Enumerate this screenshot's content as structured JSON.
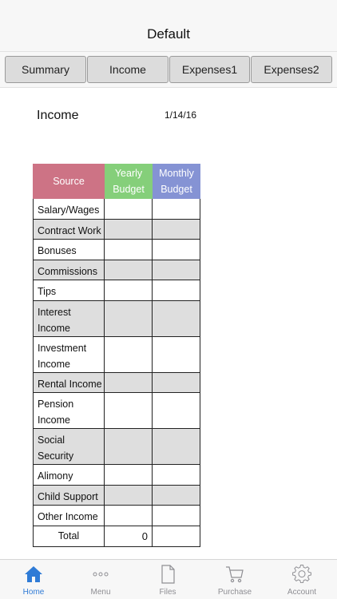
{
  "header": {
    "title": "Default"
  },
  "segments": [
    "Summary",
    "Income",
    "Expenses1",
    "Expenses2"
  ],
  "section": {
    "title": "Income",
    "date": "1/14/16"
  },
  "table": {
    "headers": {
      "source": "Source",
      "yearly_line1": "Yearly",
      "yearly_line2": "Budget",
      "monthly_line1": "Monthly",
      "monthly_line2": "Budget"
    },
    "rows": [
      {
        "line1": "Salary/Wages",
        "line2": ""
      },
      {
        "line1": "Contract Work",
        "line2": ""
      },
      {
        "line1": "Bonuses",
        "line2": ""
      },
      {
        "line1": "Commissions",
        "line2": ""
      },
      {
        "line1": "Tips",
        "line2": ""
      },
      {
        "line1": "Interest",
        "line2": "Income"
      },
      {
        "line1": "Investment",
        "line2": "Income"
      },
      {
        "line1": "Rental Income",
        "line2": ""
      },
      {
        "line1": "Pension",
        "line2": "Income"
      },
      {
        "line1": "Social",
        "line2": "Security"
      },
      {
        "line1": "Alimony",
        "line2": ""
      },
      {
        "line1": "Child Support",
        "line2": ""
      },
      {
        "line1": "Other Income",
        "line2": ""
      }
    ],
    "total_label": "Total",
    "total_yearly": "0"
  },
  "tabs": [
    {
      "label": "Home",
      "icon": "home-icon",
      "active": true
    },
    {
      "label": "Menu",
      "icon": "more-icon",
      "active": false
    },
    {
      "label": "Files",
      "icon": "file-icon",
      "active": false
    },
    {
      "label": "Purchase",
      "icon": "cart-icon",
      "active": false
    },
    {
      "label": "Account",
      "icon": "gear-icon",
      "active": false
    }
  ],
  "colors": {
    "accent": "#2f7bd6",
    "source_header": "#cd7385",
    "yearly_header": "#85cf7a",
    "monthly_header": "#8593d4",
    "row_shade": "#dedede"
  }
}
